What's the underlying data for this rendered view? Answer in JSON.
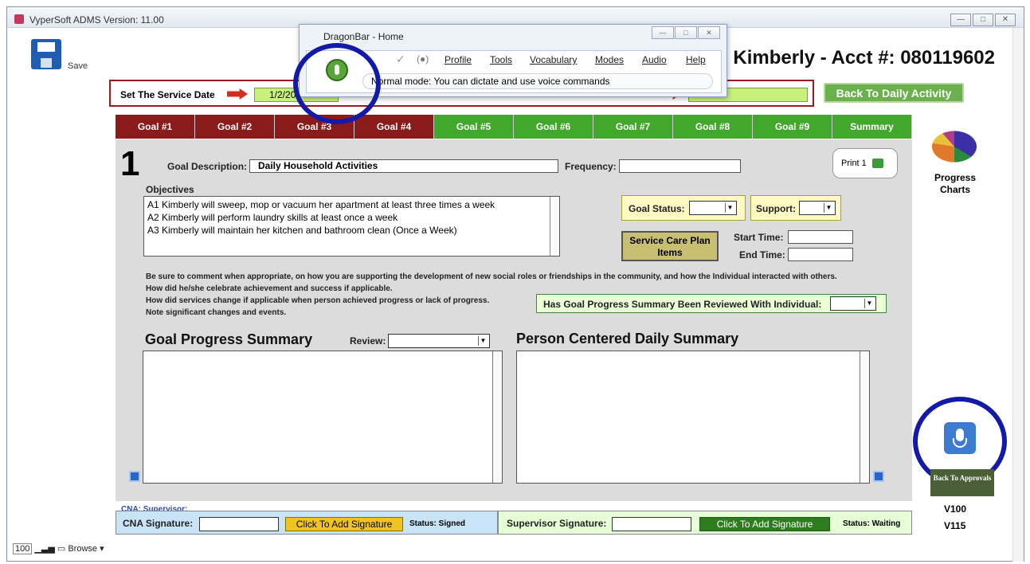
{
  "window": {
    "title": "VyperSoft ADMS Version: 11.00",
    "min": "—",
    "max": "□",
    "close": "✕"
  },
  "toolbar": {
    "save_label": "Save"
  },
  "client": {
    "title": "Kimberly - Acct #: 080119602"
  },
  "service": {
    "date_label": "Set The Service Date",
    "date_value": "1/2/20",
    "back_daily": "Back To Daily Activity"
  },
  "tabs": [
    {
      "label": "Goal #1",
      "color": "red"
    },
    {
      "label": "Goal #2",
      "color": "red"
    },
    {
      "label": "Goal #3",
      "color": "red"
    },
    {
      "label": "Goal #4",
      "color": "red"
    },
    {
      "label": "Goal #5",
      "color": "green"
    },
    {
      "label": "Goal #6",
      "color": "green"
    },
    {
      "label": "Goal #7",
      "color": "green"
    },
    {
      "label": "Goal #8",
      "color": "green"
    },
    {
      "label": "Goal #9",
      "color": "green"
    },
    {
      "label": "Summary",
      "color": "green"
    }
  ],
  "goal": {
    "number": "1",
    "description_label": "Goal Description:",
    "description_value": "Daily Household Activities",
    "frequency_label": "Frequency:",
    "print_label": "Print 1",
    "objectives_label": "Objectives",
    "objectives": [
      "A1 Kimberly will sweep, mop or vacuum her apartment at least three times a week",
      "A2 Kimberly will perform laundry skills at least once a week",
      "A3 Kimberly will maintain her kitchen and bathroom clean (Once a Week)"
    ],
    "goal_status_label": "Goal Status:",
    "support_label": "Support:",
    "service_care_plan": "Service Care Plan Items",
    "start_time_label": "Start Time:",
    "end_time_label": "End Time:"
  },
  "notes": [
    "Be sure to comment when appropriate, on how you are supporting the development of new social roles or friendships in the community, and how the Individual interacted with others.",
    "How did he/she celebrate achievement and success if applicable.",
    "How did services change if applicable when person achieved progress or lack of progress.",
    "Note significant changes and events."
  ],
  "reviewed_label": "Has Goal Progress Summary Been Reviewed With Individual:",
  "summary": {
    "goal_progress_title": "Goal Progress Summary",
    "review_label": "Review:",
    "person_centered_title": "Person Centered Daily Summary"
  },
  "cna_line": "CNA:   Supervisor:",
  "signatures": {
    "cna_label": "CNA Signature:",
    "cna_button": "Click To Add Signature",
    "cna_status": "Status:  Signed",
    "sup_label": "Supervisor Signature:",
    "sup_button": "Click To Add Signature",
    "sup_status": "Status: Waiting"
  },
  "side": {
    "progress_charts": "Progress Charts",
    "back_approvals": "Back To Approvals",
    "v100": "V100",
    "v115": "V115"
  },
  "statusbar": {
    "zoom": "100",
    "mode": "Browse"
  },
  "dragon": {
    "title": "DragonBar - Home",
    "menu": [
      "Profile",
      "Tools",
      "Vocabulary",
      "Modes",
      "Audio",
      "Help"
    ],
    "status": "Normal mode: You can dictate and use voice commands"
  }
}
